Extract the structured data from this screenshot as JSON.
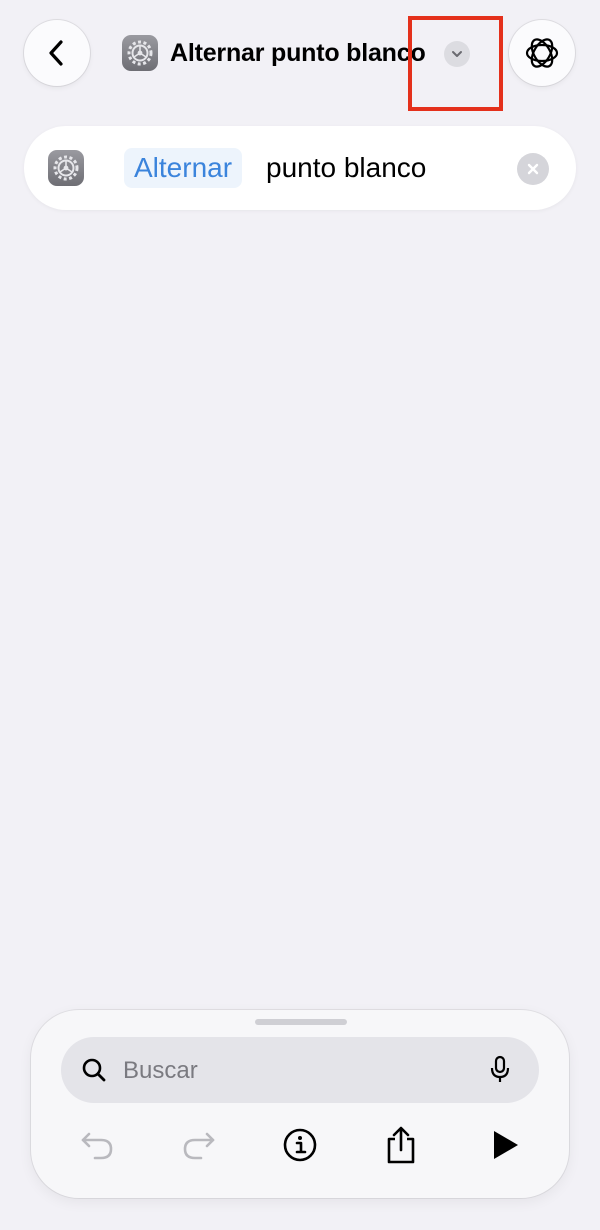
{
  "header": {
    "title": "Alternar punto blanco",
    "back_icon": "chevron-left-icon",
    "app_icon": "settings-gear-icon",
    "title_menu_icon": "chevron-down-icon",
    "magic_icon": "apple-intelligence-icon"
  },
  "action": {
    "parameter": "Alternar",
    "text": "punto blanco",
    "icon": "settings-gear-icon",
    "clear_icon": "clear-x-icon"
  },
  "bottom_panel": {
    "search": {
      "placeholder": "Buscar",
      "value": ""
    },
    "toolbar": [
      {
        "icon": "undo-icon",
        "enabled": false
      },
      {
        "icon": "redo-icon",
        "enabled": false
      },
      {
        "icon": "info-icon",
        "enabled": true
      },
      {
        "icon": "share-icon",
        "enabled": true
      },
      {
        "icon": "play-icon",
        "enabled": true
      }
    ]
  },
  "colors": {
    "background": "#f2f1f6",
    "accent_blue": "#3b84dc",
    "highlight_red": "#e4301b"
  }
}
